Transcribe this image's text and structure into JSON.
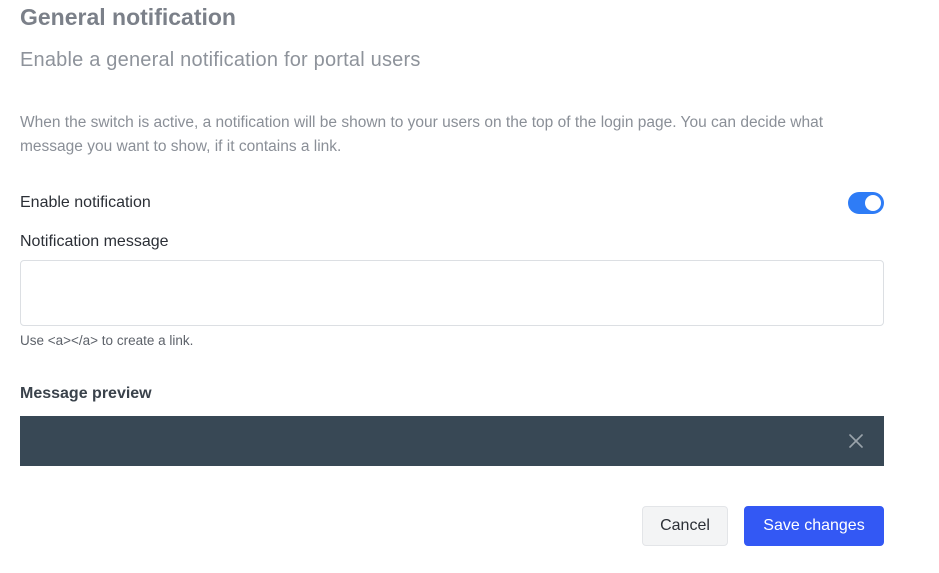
{
  "header": {
    "title": "General notification",
    "subtitle": "Enable a general notification for portal users"
  },
  "description": "When the switch is active, a notification will be shown to your users on the top of the login page. You can decide what message you want to show, if it contains a link.",
  "enable_notification": {
    "label": "Enable notification",
    "enabled": true,
    "toggle_color": "#2e7cf6"
  },
  "notification_message": {
    "label": "Notification message",
    "value": "",
    "placeholder": "",
    "help_text": "Use <a></a> to create a link."
  },
  "message_preview": {
    "label": "Message preview",
    "text": "",
    "bar_color": "#384855",
    "close_icon": "close-icon"
  },
  "actions": {
    "cancel_label": "Cancel",
    "save_label": "Save changes",
    "save_color": "#3358f4"
  }
}
